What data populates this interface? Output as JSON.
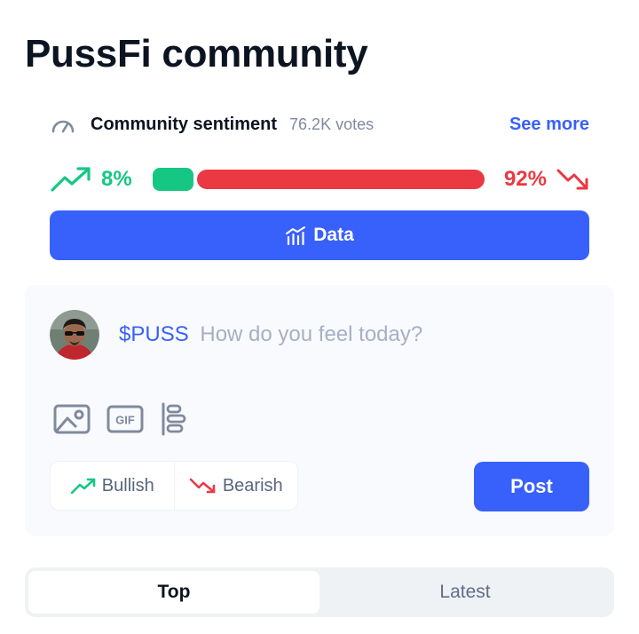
{
  "page": {
    "title": "PussFi community"
  },
  "sentiment": {
    "label": "Community sentiment",
    "votes": "76.2K votes",
    "see_more": "See more",
    "bullish_percent_text": "8%",
    "bearish_percent_text": "92%",
    "bullish_fraction": 0.08,
    "bearish_fraction": 0.92,
    "icon": "gauge-icon"
  },
  "data_button": {
    "label": "Data",
    "icon": "bar-chart-icon"
  },
  "composer": {
    "ticker": "$PUSS",
    "placeholder": "How do you feel today?",
    "tools": [
      "image-icon",
      "gif-icon",
      "poll-icon"
    ],
    "bullish_label": "Bullish",
    "bearish_label": "Bearish",
    "post_label": "Post"
  },
  "tabs": [
    {
      "label": "Top",
      "active": true
    },
    {
      "label": "Latest",
      "active": false
    }
  ],
  "colors": {
    "accent": "#3861fb",
    "bullish": "#16c784",
    "bearish": "#ea3943"
  }
}
